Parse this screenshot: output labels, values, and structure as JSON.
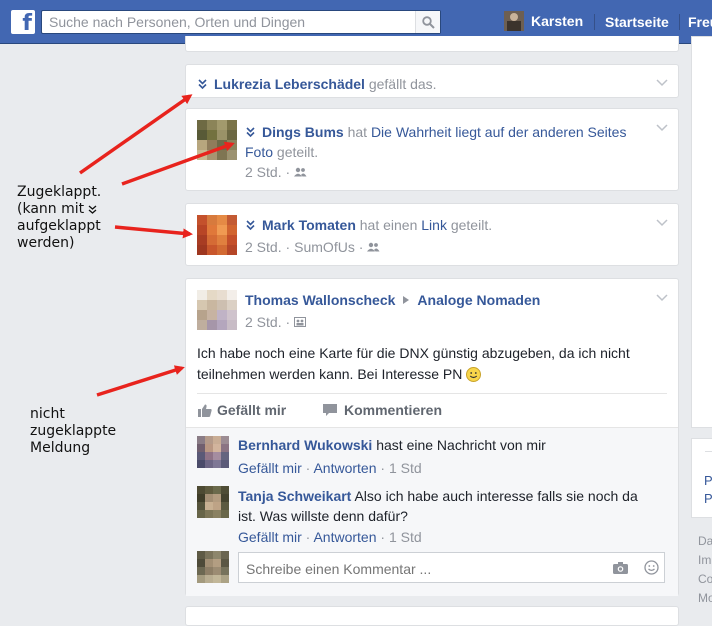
{
  "topbar": {
    "logo": "f",
    "search_placeholder": "Suche nach Personen, Orten und Dingen",
    "user_name": "Karsten",
    "nav_home": "Startseite",
    "nav_friends": "Freu"
  },
  "post1": {
    "name": "Lukrezia Leberschädel",
    "action": "gefällt das."
  },
  "post2": {
    "name": "Dings Bums",
    "verb": "hat",
    "link": "Die Wahrheit liegt auf der anderen Seites",
    "link2": "Foto",
    "tail": "geteilt.",
    "time": "2 Std. ·"
  },
  "post3": {
    "name": "Mark Tomaten",
    "verb": "hat einen",
    "link": "Link",
    "tail": "geteilt.",
    "time": "2 Std. ·",
    "via": "SumOfUs ·"
  },
  "post4": {
    "name": "Thomas Wallonscheck",
    "group": "Analoge Nomaden",
    "time": "2 Std. ·",
    "text_line1": "Ich habe noch eine Karte für die DNX günstig abzugeben, da ich nicht",
    "text_line2": "teilnehmen werden kann. Bei Interesse PN",
    "like": "Gefällt mir",
    "comment": "Kommentieren",
    "comments": [
      {
        "name": "Bernhard Wukowski",
        "text": "hast eine Nachricht von mir",
        "like": "Gefällt mir",
        "reply": "Antworten",
        "time": "1 Std"
      },
      {
        "name": "Tanja Schweikart",
        "text_line1": "Also ich habe auch interesse falls sie noch da",
        "text_line2": "ist. Was willste denn dafür?",
        "like": "Gefällt mir",
        "reply": "Antworten",
        "time": "1 Std"
      }
    ],
    "comment_placeholder": "Schreibe einen Kommentar ..."
  },
  "annotations": {
    "collapsed_line1": "Zugeklappt.",
    "collapsed_line2": "(kann mit",
    "collapsed_line3": "aufgeklappt",
    "collapsed_line4": "werden)",
    "open_line1": "nicht",
    "open_line2": "zugeklappte",
    "open_line3": "Meldung"
  },
  "right_column": {
    "letter1": "P",
    "letter2": "P",
    "footer_lines": [
      "Da",
      "Im",
      "Co",
      "Mo"
    ]
  },
  "colors": {
    "facebook_blue": "#4267b2",
    "link_blue": "#365899",
    "arrow_red": "#e8231d",
    "page_bg": "#e9ebee"
  }
}
